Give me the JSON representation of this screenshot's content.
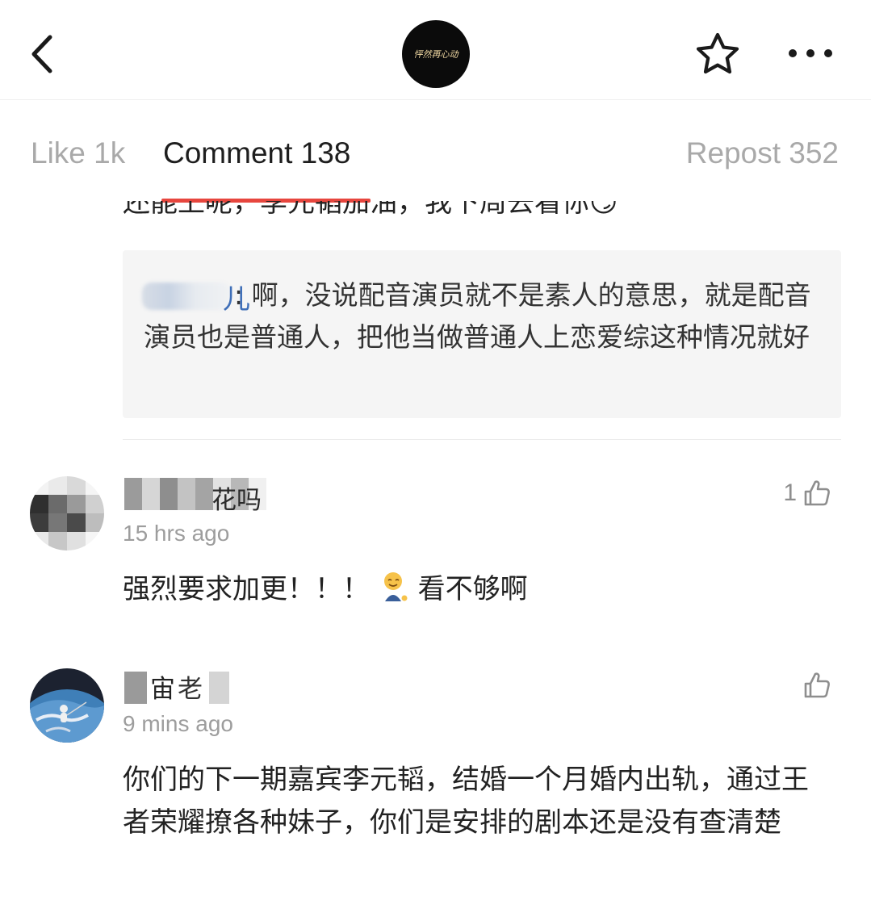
{
  "header": {
    "logo_text": "怦然再心动",
    "back_icon": "chevron-left-icon",
    "favorite_icon": "star-outline-icon",
    "more_icon": "more-horizontal-icon"
  },
  "tabs": {
    "like": "Like 1k",
    "comment": "Comment 138",
    "repost": "Repost 352",
    "active": "comment",
    "active_color": "#e7463e"
  },
  "partial_comment": {
    "text": "还能上呢，李元韬加油，我下周去看你😏"
  },
  "reply": {
    "author_tail": "儿",
    "text": ": 啊，没说配音演员就不是素人的意思，就是配音演员也是普通人，把他当做普通人上恋爱综这种情况就好"
  },
  "comments": [
    {
      "name_visible": "花吗",
      "time": "15 hrs ago",
      "likes": "1",
      "text_before": "强烈要求加更！！！ ",
      "emoji": "smiling-face-sitting-emoji",
      "text_after": "看不够啊"
    },
    {
      "name_visible_1": "宙",
      "name_visible_2": "老",
      "time": "9 mins ago",
      "likes": "",
      "text": "你们的下一期嘉宾李元韬，结婚一个月婚内出轨，通过王者荣耀撩各种妹子，你们是安排的剧本还是没有查清楚"
    }
  ],
  "colors": {
    "accent": "#e7463e",
    "muted": "#a9a9a9",
    "reply_bg": "#f5f5f5",
    "reply_name": "#3f6fb8"
  }
}
